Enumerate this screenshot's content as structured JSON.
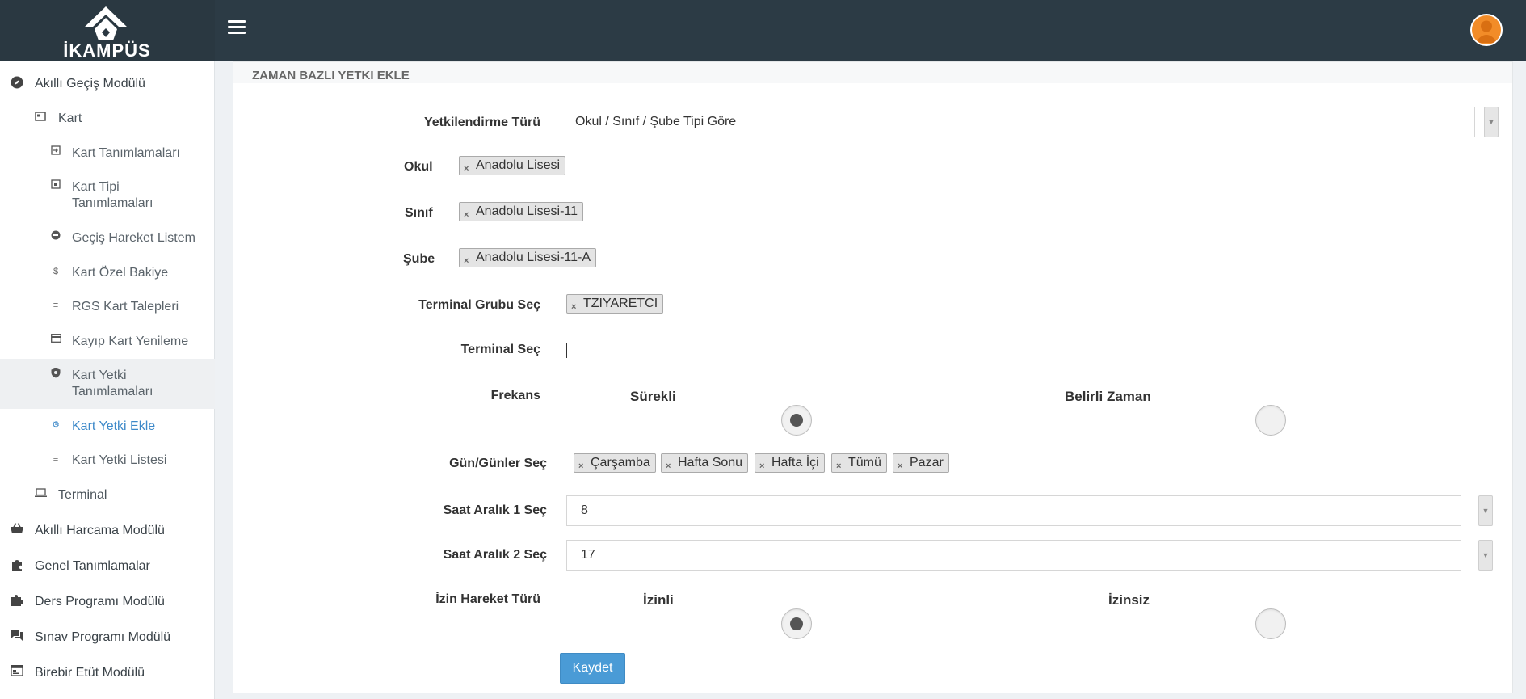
{
  "header": {
    "logo_text": "İKAMPÜS",
    "menu_icon": "hamburger-icon",
    "avatar_icon": "user-avatar-icon"
  },
  "sidebar": {
    "items": [
      {
        "label": "Akıllı Geçiş Modülü",
        "icon": "compass-icon"
      },
      {
        "label": "Kart",
        "icon": "card-icon"
      },
      {
        "label": "Kart Tanımlamaları",
        "icon": "sign-in-icon"
      },
      {
        "label": "Kart Tipi Tanımlamaları",
        "icon": "expand-icon"
      },
      {
        "label": "Geçiş Hareket Listem",
        "icon": "minus-circle-icon"
      },
      {
        "label": "Kart Özel Bakiye",
        "icon": "dollar-icon"
      },
      {
        "label": "RGS Kart Talepleri",
        "icon": "list-icon"
      },
      {
        "label": "Kayıp Kart Yenileme",
        "icon": "credit-card-icon"
      },
      {
        "label": "Kart Yetki Tanımlamaları",
        "icon": "shield-icon"
      },
      {
        "label": "Kart Yetki Ekle",
        "icon": "gear-icon"
      },
      {
        "label": "Kart Yetki Listesi",
        "icon": "list-icon"
      },
      {
        "label": "Terminal",
        "icon": "laptop-icon"
      },
      {
        "label": "Akıllı Harcama Modülü",
        "icon": "basket-icon"
      },
      {
        "label": "Genel Tanımlamalar",
        "icon": "puzzle-icon"
      },
      {
        "label": "Ders Programı Modülü",
        "icon": "puzzle-piece-icon"
      },
      {
        "label": "Sınav Programı Modülü",
        "icon": "comments-icon"
      },
      {
        "label": "Birebir Etüt Modülü",
        "icon": "calendar-icon"
      }
    ]
  },
  "form": {
    "title": "ZAMAN BAZLI YETKI EKLE",
    "yetki_turu": {
      "label": "Yetkilendirme Türü",
      "value": "Okul / Sınıf / Şube Tipi Göre"
    },
    "okul": {
      "label": "Okul",
      "tags": [
        "Anadolu Lisesi"
      ]
    },
    "sinif": {
      "label": "Sınıf",
      "tags": [
        "Anadolu Lisesi-11"
      ]
    },
    "sube": {
      "label": "Şube",
      "tags": [
        "Anadolu Lisesi-11-A"
      ]
    },
    "terminal_grubu": {
      "label": "Terminal Grubu Seç",
      "tags": [
        "TZIYARETCI"
      ]
    },
    "terminal": {
      "label": "Terminal Seç"
    },
    "frekans": {
      "label": "Frekans",
      "options": [
        "Sürekli",
        "Belirli Zaman"
      ],
      "selected": "Sürekli"
    },
    "gunler": {
      "label": "Gün/Günler Seç",
      "tags": [
        "Çarşamba",
        "Hafta Sonu",
        "Hafta İçi",
        "Tümü",
        "Pazar"
      ]
    },
    "saat1": {
      "label": "Saat Aralık 1 Seç",
      "value": "8"
    },
    "saat2": {
      "label": "Saat Aralık 2 Seç",
      "value": "17"
    },
    "izin": {
      "label": "İzin Hareket Türü",
      "options": [
        "İzinli",
        "İzinsiz"
      ],
      "selected": "İzinli"
    },
    "save_label": "Kaydet",
    "remove_glyph": "×",
    "arrow_glyph": "▼"
  },
  "colors": {
    "header_bg": "#2c3b45",
    "accent": "#3d89c9",
    "button_bg": "#4a9bd6",
    "avatar": "#f28c28"
  }
}
